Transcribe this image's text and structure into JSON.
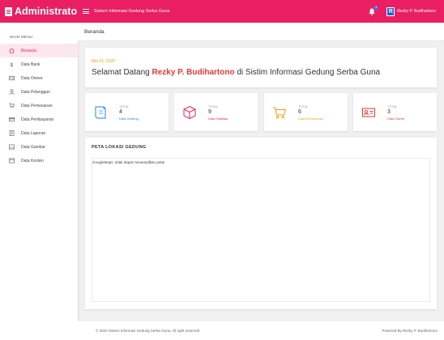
{
  "brand": {
    "title": "Administrator",
    "icon": "document-icon"
  },
  "topbar": {
    "app_title": "Sistem Informasi Gedung Serba Guna",
    "notification_count": "4",
    "user_initial": "R",
    "user_name": "Rezky P. Budihartono",
    "accent_color": "#e91e63"
  },
  "sidebar": {
    "heading": "MAIN MENU",
    "items": [
      {
        "label": "Beranda",
        "icon": "home-icon",
        "active": true
      },
      {
        "label": "Data Bank",
        "icon": "dollar-icon"
      },
      {
        "label": "Data Owner",
        "icon": "id-card-icon"
      },
      {
        "label": "Data Pelanggan",
        "icon": "user-icon"
      },
      {
        "label": "Data Pemesanan",
        "icon": "cart-icon"
      },
      {
        "label": "Data Pembayaran",
        "icon": "credit-card-icon"
      },
      {
        "label": "Data Laporan",
        "icon": "report-icon"
      },
      {
        "label": "Data Gambar",
        "icon": "image-icon"
      },
      {
        "label": "Data Konten",
        "icon": "window-icon"
      }
    ]
  },
  "breadcrumb": "Beranda",
  "welcome": {
    "date": "Mei 01, 2020",
    "prefix": "Selamat Datang ",
    "name": "Rezky P. Budihartono",
    "suffix": " di Sistim Informasi Gedung Serba Guna"
  },
  "stats": [
    {
      "label": "TOTAL",
      "value": "4",
      "link": "Data Gedung",
      "color": "#1e88e5",
      "icon": "building-icon"
    },
    {
      "label": "TOTAL",
      "value": "9",
      "link": "Data Fasilitas",
      "color": "#e91e63",
      "icon": "box-icon"
    },
    {
      "label": "TOTAL",
      "value": "6",
      "link": "Data Pemesanan",
      "color": "#f39c12",
      "icon": "cart-icon"
    },
    {
      "label": "TOTAL",
      "value": "3",
      "link": "Data Owner",
      "color": "#e53935",
      "icon": "id-card-icon"
    }
  ],
  "map": {
    "title": "PETA LOKASI GEDUNG",
    "message": "GoogleMaps, tidak dapat menampilkan peta!"
  },
  "footer": {
    "copyright": "© 2020 Sistem Informasi Gedung Serba Guna. All right reserved",
    "powered": "Powered By Rezky P. Budihartono"
  }
}
